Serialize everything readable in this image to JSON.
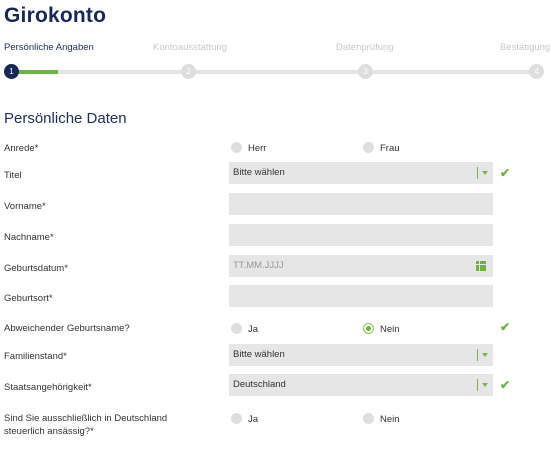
{
  "page_title": "Girokonto",
  "steps": [
    {
      "label": "Persönliche Angaben",
      "number": "1"
    },
    {
      "label": "Kontoausstattung",
      "number": "2"
    },
    {
      "label": "Datenprüfung",
      "number": "3"
    },
    {
      "label": "Bestätigung",
      "number": "4"
    }
  ],
  "progress": {
    "current_step": 1,
    "total_steps": 4
  },
  "section_title": "Persönliche Daten",
  "form": {
    "anrede": {
      "label": "Anrede*",
      "option1": "Herr",
      "option2": "Frau"
    },
    "titel": {
      "label": "Titel",
      "value": "Bitte wählen"
    },
    "vorname": {
      "label": "Vorname*",
      "value": ""
    },
    "nachname": {
      "label": "Nachname*",
      "value": ""
    },
    "geburtsdatum": {
      "label": "Geburtsdatum*",
      "placeholder": "TT.MM.JJJJ"
    },
    "geburtsort": {
      "label": "Geburtsort*",
      "value": ""
    },
    "abweichender_geburtsname": {
      "label": "Abweichender Geburtsname?",
      "option1": "Ja",
      "option2": "Nein",
      "selected": "Nein"
    },
    "familienstand": {
      "label": "Familienstand*",
      "value": "Bitte wählen"
    },
    "staatsangehoerigkeit": {
      "label": "Staatsangehörigkeit*",
      "value": "Deutschland"
    },
    "steuerlich_ansaessig": {
      "label": "Sind Sie ausschließlich in Deutschland steuerlich ansässig?*",
      "option1": "Ja",
      "option2": "Nein"
    }
  },
  "check_symbol": "✔",
  "colors": {
    "accent_green": "#6cb33f",
    "brand_navy": "#16285a",
    "field_bg": "#e6e6e6"
  }
}
